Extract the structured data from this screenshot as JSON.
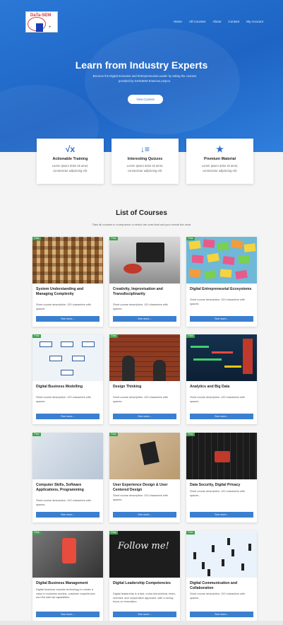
{
  "logo": {
    "text": "DaTa-SEM",
    "mark": "+"
  },
  "nav": [
    "Home",
    "All Courses",
    "About",
    "Contact",
    "My Account"
  ],
  "hero": {
    "title": "Learn from Industry Experts",
    "subtitle": "Become the Digital Innovator and Entrepreneurial Leader by taking the courses provided by DaTaSEM Erasmus project.",
    "button": "View Courses"
  },
  "features": [
    {
      "icon": "√x",
      "title": "Actionable Training",
      "desc": "Lorem ipsum dolor sit amet, consectetur adipiscing elit."
    },
    {
      "icon": "↓≡",
      "title": "Interesting Quizzes",
      "desc": "Lorem ipsum dolor sit amet, consectetur adipiscing elit."
    },
    {
      "icon": "★",
      "title": "Premium Material",
      "desc": "Lorem ipsum dolor sit amet, consectetur adipiscing elit."
    }
  ],
  "courses_section": {
    "title": "List of Courses",
    "subtitle": "Take all courses in a sequence or select the ones that suit your needs the most"
  },
  "badge_label": "Free",
  "button_label": "See more...",
  "courses": [
    {
      "title": "System Understanding and Managing Complexity",
      "desc": "Short course description: 120 characters with spaces."
    },
    {
      "title": "Creativity, Improvisation and Transdisciplinarity",
      "desc": "Short course description: 120 characters with spaces."
    },
    {
      "title": "Digital Entrepreneurial Ecosystems",
      "desc": "Short course description: 120 characters with spaces."
    },
    {
      "title": "Digital Business Modelling",
      "desc": "Short course description: 120 characters with spaces."
    },
    {
      "title": "Design Thinking",
      "desc": "Short course description: 120 characters with spaces."
    },
    {
      "title": "Analytics and Big Data",
      "desc": "Short course description: 120 characters with spaces."
    },
    {
      "title": "Computer Skills, Software Applications, Programming",
      "desc": "Short course description: 120 characters with spaces."
    },
    {
      "title": "User Experience Design & User Centered Design",
      "desc": "Short course description: 120 characters with spaces."
    },
    {
      "title": "Data Security, Digital Privacy",
      "desc": "Short course description: 120 characters with spaces."
    },
    {
      "title": "Digital Business Management",
      "desc": "Digital business exploits technology to create a value in business models, customer experiences and the internal capabilities."
    },
    {
      "title": "Digital Leadership Competencies",
      "desc": "Digital leadership is a fast, cross-hierarchical, team-oriented, and cooperative approach, with a strong focus on innovation."
    },
    {
      "title": "Digital Communication and Collaboration",
      "desc": "Short course description: 120 characters with spaces."
    }
  ],
  "image_text": {
    "follow": "Follow me!"
  },
  "colors": {
    "primary": "#2a6fd0",
    "badge": "#3aa54a",
    "button": "#3a7fd0"
  }
}
